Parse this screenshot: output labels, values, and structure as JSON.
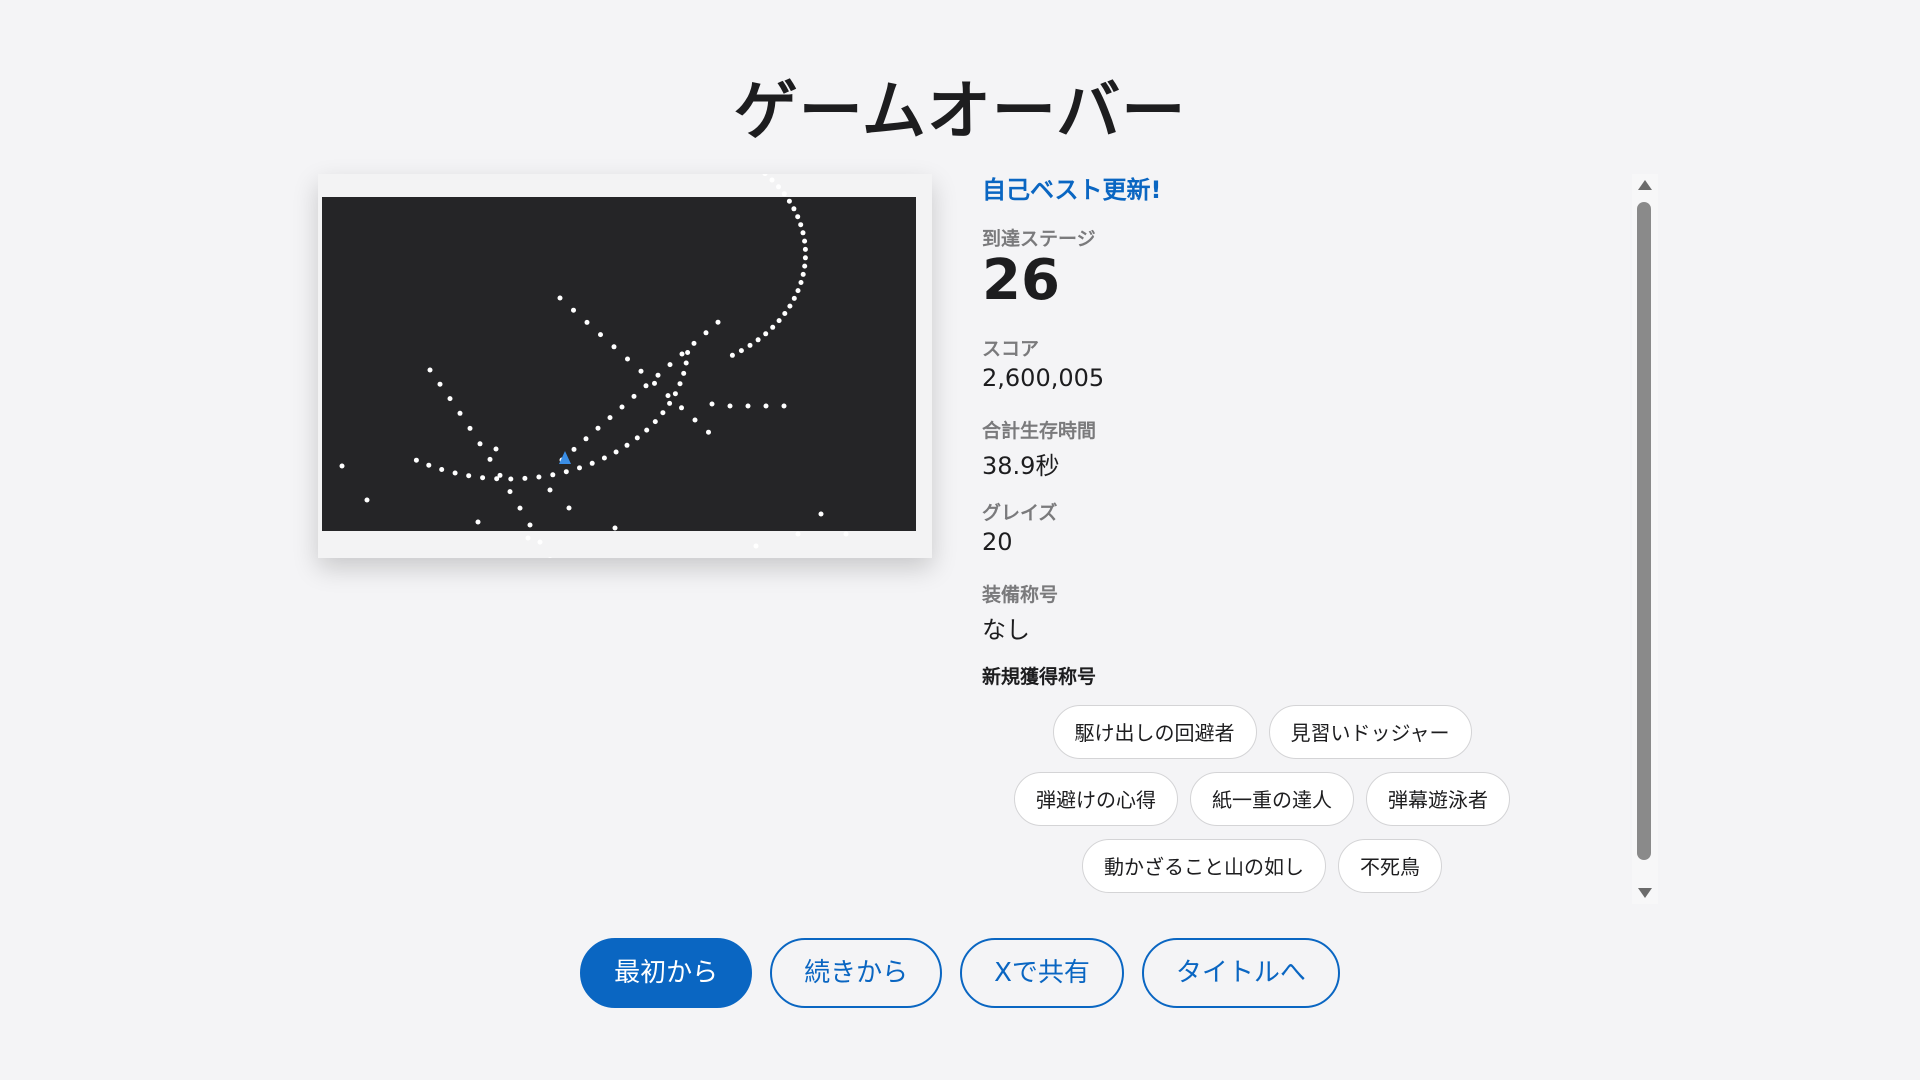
{
  "title": "ゲームオーバー",
  "result": {
    "best_banner": "自己ベスト更新!",
    "stage_label": "到達ステージ",
    "stage_value": "26",
    "score_label": "スコア",
    "score_value": "2,600,005",
    "time_label": "合計生存時間",
    "time_value": "38.9秒",
    "graze_label": "グレイズ",
    "graze_value": "20",
    "equipped_title_label": "装備称号",
    "equipped_title_value": "なし",
    "new_titles_label": "新規獲得称号",
    "new_titles": [
      "駆け出しの回避者",
      "見習いドッジャー",
      "弾避けの心得",
      "紙一重の達人",
      "弾幕遊泳者",
      "動かざること山の如し",
      "不死鳥"
    ]
  },
  "buttons": {
    "restart": "最初から",
    "continue": "続きから",
    "share": "Xで共有",
    "to_title": "タイトルへ"
  },
  "colors": {
    "accent": "#0a66c2",
    "background": "#f4f4f6",
    "game_field": "#252527",
    "bullet": "#ffffff",
    "player": "#3a8ee6"
  },
  "icons": {
    "scroll_up": "triangle-up-icon",
    "scroll_down": "triangle-down-icon",
    "player": "player-ship-icon"
  }
}
